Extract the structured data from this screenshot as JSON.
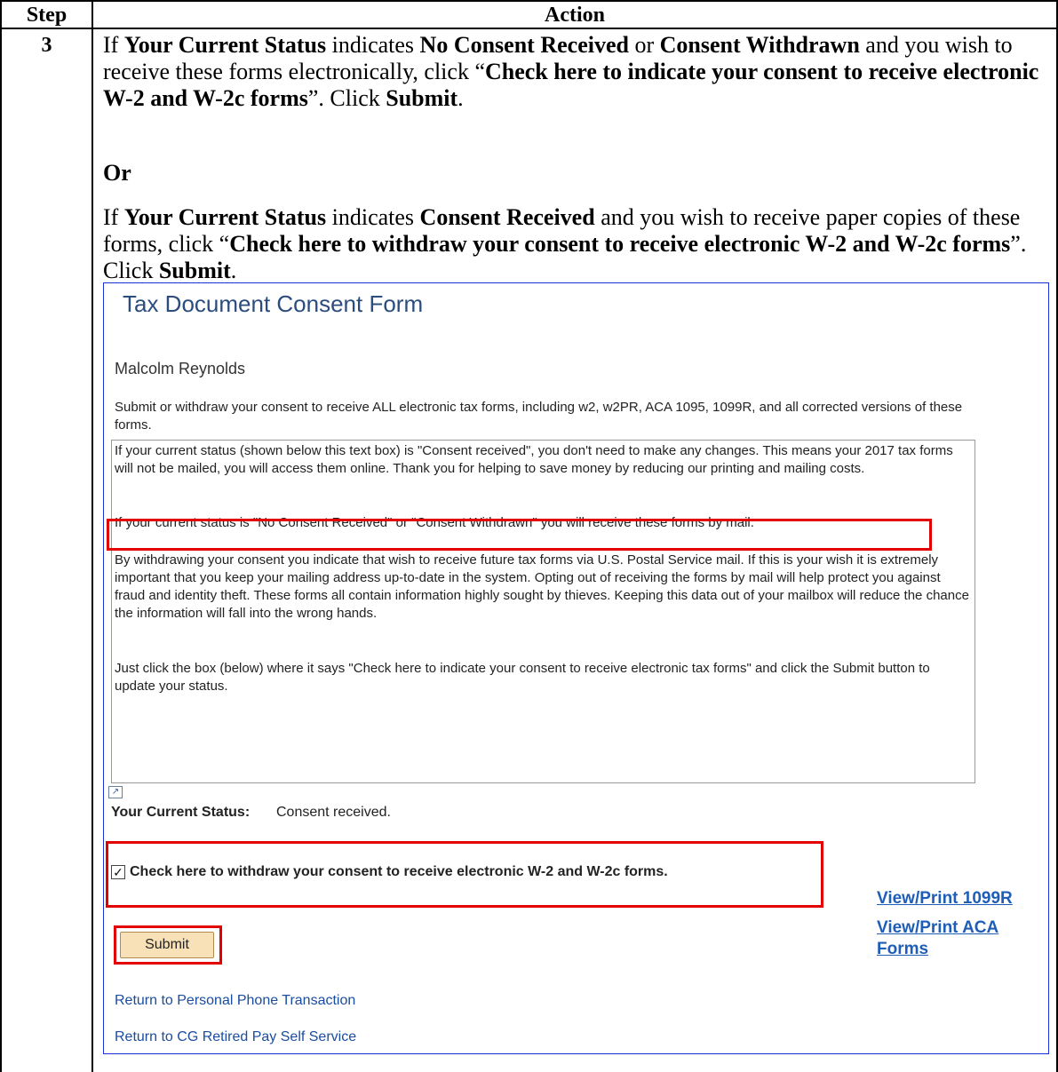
{
  "table": {
    "header_step": "Step",
    "header_action": "Action",
    "step_number": "3"
  },
  "instructions": {
    "p1": [
      {
        "t": "If ",
        "b": false
      },
      {
        "t": "Your Current Status",
        "b": true
      },
      {
        "t": " indicates ",
        "b": false
      },
      {
        "t": "No Consent Received",
        "b": true
      },
      {
        "t": " or ",
        "b": false
      },
      {
        "t": "Consent Withdrawn",
        "b": true
      },
      {
        "t": " and you wish to receive these forms electronically, click “",
        "b": false
      },
      {
        "t": "Check here to indicate your consent to receive electronic W-2 and W-2c forms",
        "b": true
      },
      {
        "t": "”.  Click ",
        "b": false
      },
      {
        "t": "Submit",
        "b": true
      },
      {
        "t": ".",
        "b": false
      }
    ],
    "or": "Or",
    "p2": [
      {
        "t": "If ",
        "b": false
      },
      {
        "t": "Your Current Status",
        "b": true
      },
      {
        "t": " indicates ",
        "b": false
      },
      {
        "t": "Consent Received",
        "b": true
      },
      {
        "t": " and you wish to receive paper copies of these forms, click “",
        "b": false
      },
      {
        "t": "Check here to withdraw your consent to receive electronic W-2 and W-2c forms",
        "b": true
      },
      {
        "t": "”.  Click ",
        "b": false
      },
      {
        "t": "Submit",
        "b": true
      },
      {
        "t": ".",
        "b": false
      }
    ]
  },
  "form": {
    "title": "Tax Document Consent Form",
    "person_name": "Malcolm Reynolds",
    "intro": "Submit or withdraw your consent to receive ALL electronic tax forms, including w2, w2PR, ACA 1095, 1099R, and all corrected versions of these forms.",
    "textbox": {
      "para1": "If your current status (shown below this text box) is \"Consent received\", you don't need to make any changes. This means your 2017 tax forms will not be mailed, you will access them online. Thank you for helping to save money by reducing our printing and mailing costs.",
      "para2": "If your current status is \"No Consent Received\" or  \"Consent Withdrawn\" you will  receive these forms by mail.",
      "para3": "By withdrawing your consent you indicate that wish to receive future tax forms via U.S. Postal Service mail. If this is your wish it is extremely important that you keep your mailing address up-to-date in the system. Opting out of receiving the forms by mail will help protect you against fraud and identity theft. These forms all contain information highly sought by thieves. Keeping this data out of your mailbox will reduce the chance the information will fall into the wrong hands.",
      "para4": "Just click the box (below) where it says \"Check here to indicate your consent to receive electronic tax forms\" and click the Submit button to update your status."
    },
    "status_label": "Your Current Status:",
    "status_value": "Consent received.",
    "checkbox_checked": true,
    "checkbox_label": "Check here to withdraw your consent to receive electronic W-2 and W-2c forms.",
    "submit_label": "Submit",
    "link_1099r": "View/Print 1099R",
    "link_aca_line1": "View/Print ACA",
    "link_aca_line2": "Forms",
    "link_return_phone": "Return to Personal Phone Transaction",
    "link_return_cg": "Return to CG Retired Pay Self Service",
    "accent_color": "#2b4c7e",
    "highlight_color": "#e30000",
    "link_color": "#1f5eb6"
  }
}
